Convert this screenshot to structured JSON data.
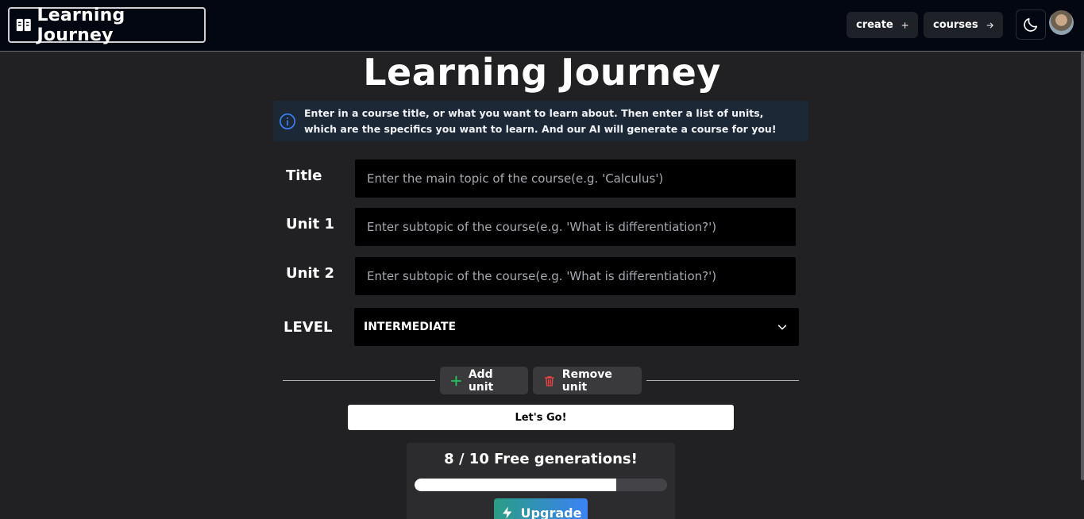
{
  "navbar": {
    "brand": "Learning Journey",
    "create_label": "create",
    "courses_label": "courses"
  },
  "main": {
    "title": "Learning Journey",
    "info": "Enter in a course title, or what you want to learn about. Then enter a list of units, which are the specifics you want to learn. And our AI will generate a course for you!",
    "fields": [
      {
        "label": "Title",
        "placeholder": "Enter the main topic of the course(e.g. 'Calculus')"
      },
      {
        "label": "Unit 1",
        "placeholder": "Enter subtopic of the course(e.g. 'What is differentiation?')"
      },
      {
        "label": "Unit 2",
        "placeholder": "Enter subtopic of the course(e.g. 'What is differentiation?')"
      }
    ],
    "level": {
      "label": "LEVEL",
      "value": "INTERMEDIATE"
    },
    "add_unit_label": "Add unit",
    "remove_unit_label": "Remove unit",
    "submit_label": "Let's Go!"
  },
  "generations": {
    "text": "8 / 10 Free generations!",
    "used": 8,
    "total": 10,
    "upgrade_label": "Upgrade"
  },
  "colors": {
    "accent_green": "#22c55e",
    "danger_red": "#ef4444",
    "info_blue": "#3b82f6"
  },
  "icons": [
    "book-open-icon",
    "plus-icon",
    "arrow-right-icon",
    "moon-icon",
    "info-icon",
    "chevron-down-icon",
    "trash-icon",
    "zap-icon"
  ]
}
